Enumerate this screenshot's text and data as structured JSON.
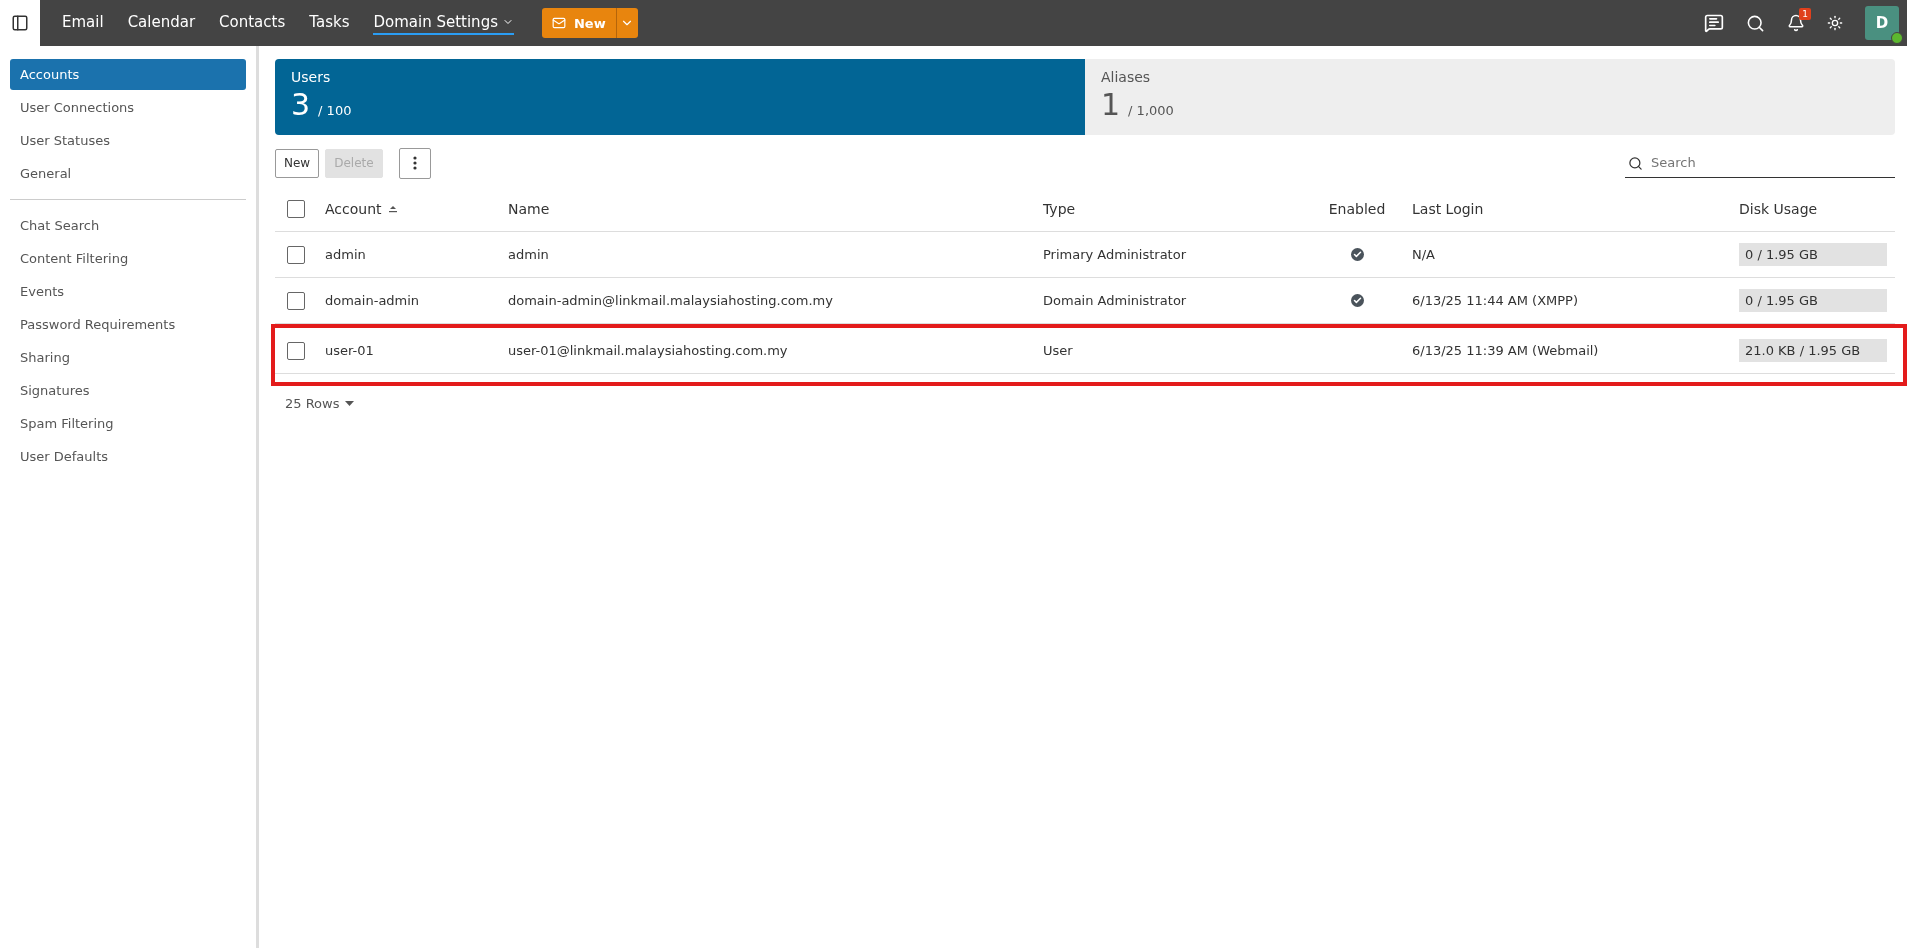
{
  "topbar": {
    "nav": [
      {
        "label": "Email",
        "selected": false,
        "dropdown": false
      },
      {
        "label": "Calendar",
        "selected": false,
        "dropdown": false
      },
      {
        "label": "Contacts",
        "selected": false,
        "dropdown": false
      },
      {
        "label": "Tasks",
        "selected": false,
        "dropdown": false
      },
      {
        "label": "Domain Settings",
        "selected": true,
        "dropdown": true
      }
    ],
    "new_button": "New",
    "notification_count": "1",
    "avatar": {
      "initial": "D",
      "online": true
    }
  },
  "sidebar": {
    "groups": [
      [
        {
          "label": "Accounts",
          "selected": true
        },
        {
          "label": "User Connections",
          "selected": false
        },
        {
          "label": "User Statuses",
          "selected": false
        },
        {
          "label": "General",
          "selected": false
        }
      ],
      [
        {
          "label": "Chat Search",
          "selected": false
        },
        {
          "label": "Content Filtering",
          "selected": false
        },
        {
          "label": "Events",
          "selected": false
        },
        {
          "label": "Password Requirements",
          "selected": false
        },
        {
          "label": "Sharing",
          "selected": false
        },
        {
          "label": "Signatures",
          "selected": false
        },
        {
          "label": "Spam Filtering",
          "selected": false
        },
        {
          "label": "User Defaults",
          "selected": false
        }
      ]
    ]
  },
  "summary_tabs": [
    {
      "label": "Users",
      "count": "3",
      "limit": "/ 100",
      "selected": true
    },
    {
      "label": "Aliases",
      "count": "1",
      "limit": "/ 1,000",
      "selected": false
    }
  ],
  "toolbar": {
    "buttons": [
      {
        "label": "New",
        "disabled": false
      },
      {
        "label": "Delete",
        "disabled": true
      }
    ],
    "search": {
      "placeholder": "Search"
    }
  },
  "table": {
    "select_all_checked": false,
    "columns": [
      "Account",
      "Name",
      "Type",
      "Enabled",
      "Last Login",
      "Disk Usage"
    ],
    "rows": [
      {
        "checked": false,
        "account": "admin",
        "name": "admin",
        "type": "Primary Administrator",
        "enabled": true,
        "last_login": "N/A",
        "disk_usage": "0 / 1.95 GB",
        "highlighted": false
      },
      {
        "checked": false,
        "account": "domain-admin",
        "name": "domain-admin@linkmail.malaysiahosting.com.my",
        "type": "Domain Administrator",
        "enabled": true,
        "last_login": "6/13/25 11:44 AM (XMPP)",
        "disk_usage": "0 / 1.95 GB",
        "highlighted": false
      },
      {
        "checked": false,
        "account": "user-01",
        "name": "user-01@linkmail.malaysiahosting.com.my",
        "type": "User",
        "enabled": false,
        "last_login": "6/13/25 11:39 AM (Webmail)",
        "disk_usage": "21.0 KB / 1.95 GB",
        "highlighted": true
      }
    ]
  },
  "pager": "25 Rows"
}
